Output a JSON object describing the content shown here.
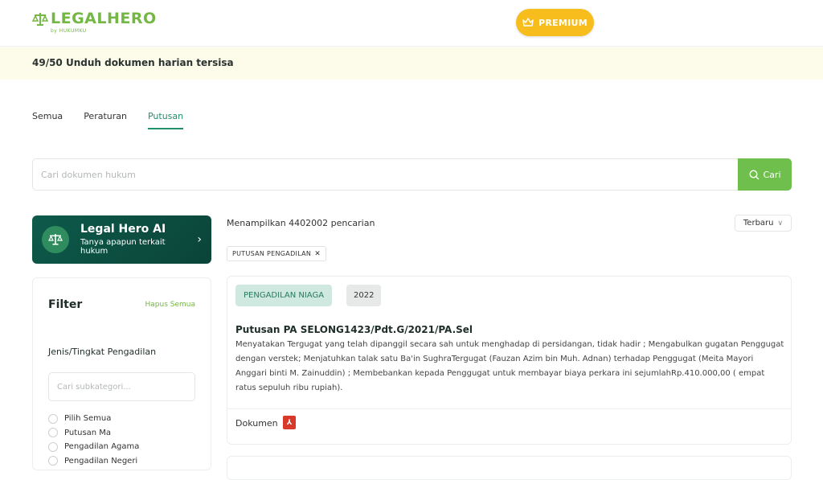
{
  "brand": {
    "name": "LEGALHERO",
    "sub": "by HUKUMKU",
    "accent": "#74b744"
  },
  "header": {
    "premium_label": "PREMIUM",
    "premium_color": "#f6bd1c",
    "premium_icon": "crown-icon"
  },
  "banner": {
    "text": "49/50 Unduh dokumen harian tersisa"
  },
  "tabs": [
    {
      "label": "Semua",
      "active": false
    },
    {
      "label": "Peraturan",
      "active": false
    },
    {
      "label": "Putusan",
      "active": true
    }
  ],
  "search": {
    "placeholder": "Cari dokumen hukum",
    "button_label": "Cari",
    "button_icon": "search-icon"
  },
  "ai_card": {
    "title": "Legal Hero AI",
    "subtitle": "Tanya apapun terkait hukum",
    "icon": "scales-icon"
  },
  "filter": {
    "title": "Filter",
    "clear_label": "Hapus Semua",
    "section_title": "Jenis/Tingkat Pengadilan",
    "sub_search_placeholder": "Cari subkategori...",
    "options": [
      "Pilih Semua",
      "Putusan Ma",
      "Pengadilan Agama",
      "Pengadilan Negeri"
    ]
  },
  "results": {
    "count_text": "Menampilkan 4402002 pencarian",
    "sort_label": "Terbaru",
    "active_chip": "PUTUSAN PENGADILAN",
    "items": [
      {
        "court": "PENGADILAN NIAGA",
        "year": "2022",
        "title": "Putusan PA SELONG1423/Pdt.G/2021/PA.Sel",
        "body": "Menyatakan Tergugat yang telah dipanggil secara sah untuk menghadap di persidangan, tidak hadir ; Mengabulkan gugatan Penggugat dengan verstek; Menjatuhkan talak satu Ba'in SughraTergugat (Fauzan Azim bin Muh. Adnan) terhadap Penggugat (Meita Mayori Anggari binti M. Zainuddin) ; Membebankan kepada Penggugat untuk membayar biaya perkara ini sejumlahRp.410.000,00 ( empat ratus sepuluh ribu rupiah).",
        "doc_label": "Dokumen",
        "doc_icon": "pdf-icon"
      }
    ]
  }
}
